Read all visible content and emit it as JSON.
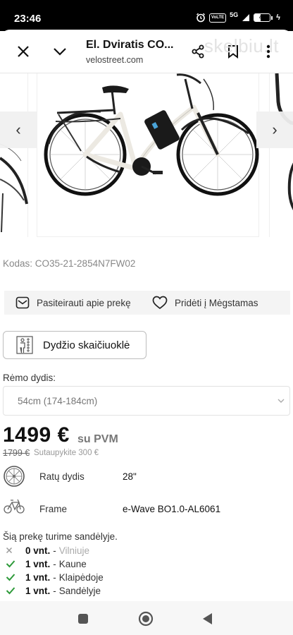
{
  "status_bar": {
    "time": "23:46",
    "network_badge": "VoLTE",
    "signal_label": "5G",
    "battery_level_pct": 41,
    "battery_text": "41",
    "charging_symbol": "ϟ"
  },
  "browser": {
    "page_title": "El. Dviratis CO...",
    "url": "velostreet.com",
    "watermark": "skelbiu.lt",
    "icons": [
      "close-icon",
      "chevron-down-icon",
      "share-icon",
      "bookmark-icon",
      "more-vert-icon"
    ]
  },
  "gallery": {
    "prev_arrow": "‹",
    "next_arrow": "›",
    "frame_color": "#ece9e2"
  },
  "product": {
    "code_line": "Kodas: CO35-21-2854N7FW02",
    "actions": {
      "inquire_label": "Pasiteirauti apie prekę",
      "favorite_label": "Pridėti į Mėgstamas"
    },
    "size_calc_label": "Dydžio skaičiuoklė",
    "frame_size_label": "Rėmo dydis:",
    "frame_size_value": "54cm (174-184cm)",
    "price": "1499 €",
    "price_suffix": "su PVM",
    "old_price": "1799 €",
    "savings": "Sutaupykite 300 €",
    "specs": [
      {
        "name": "Ratų dydis",
        "value": "28\""
      },
      {
        "name": "Frame",
        "value": "e-Wave BO1.0-AL6061"
      }
    ],
    "stock_title": "Šią prekę turime sandėlyje.",
    "stock": [
      {
        "qty": "0 vnt.",
        "sep": "-",
        "location": "Vilniuje",
        "available": false
      },
      {
        "qty": "1 vnt.",
        "sep": "-",
        "location": "Kaune",
        "available": true
      },
      {
        "qty": "1 vnt.",
        "sep": "-",
        "location": "Klaipėdoje",
        "available": true
      },
      {
        "qty": "1 vnt.",
        "sep": "-",
        "location": "Sandėlyje",
        "available": true
      }
    ]
  },
  "colors": {
    "check_green": "#2e9a3a",
    "cross_gray": "#9a9a9a"
  }
}
